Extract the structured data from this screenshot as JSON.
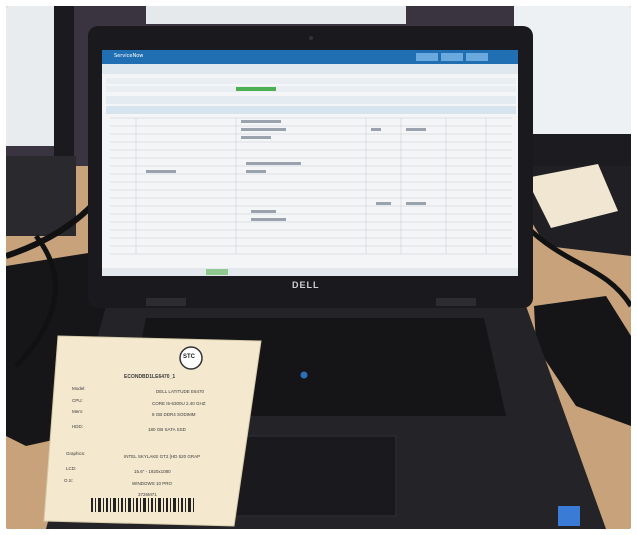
{
  "laptop": {
    "brand": "DELL",
    "screen": {
      "app_title": "ServiceNow",
      "tabs": [
        "",
        "",
        "",
        ""
      ],
      "header_text": ""
    }
  },
  "asset_label": {
    "asset_tag": "ECONDBD1LE6470_1",
    "rows": [
      {
        "key": "Model:",
        "value": "DELL LATITUDE E6470"
      },
      {
        "key": "CPU:",
        "value": "CORE I5-6300U 2.40 GHZ"
      },
      {
        "key": "Mem:",
        "value": "8 GB DDR4 SODIMM"
      },
      {
        "key": "HDD:",
        "value": "180 GB SATA SSD"
      },
      {
        "key": "Graphics:",
        "value": "INTEL SKYLAKE GT2 [HD 520 GRAP"
      },
      {
        "key": "LCD:",
        "value": "15.6\" - 1920x1080"
      },
      {
        "key": "O.S:",
        "value": "WINDOWS 10 PRO"
      },
      {
        "key": "",
        "value": "3726M71"
      }
    ],
    "logo_text": "STC"
  },
  "colors": {
    "desk": "#c9a27a",
    "laptop_body": "#1f1f24",
    "bezel": "#141417",
    "screen_bg": "#f3f5f7",
    "app_header": "#1f6fb2",
    "label_paper": "#f4e9cf"
  }
}
